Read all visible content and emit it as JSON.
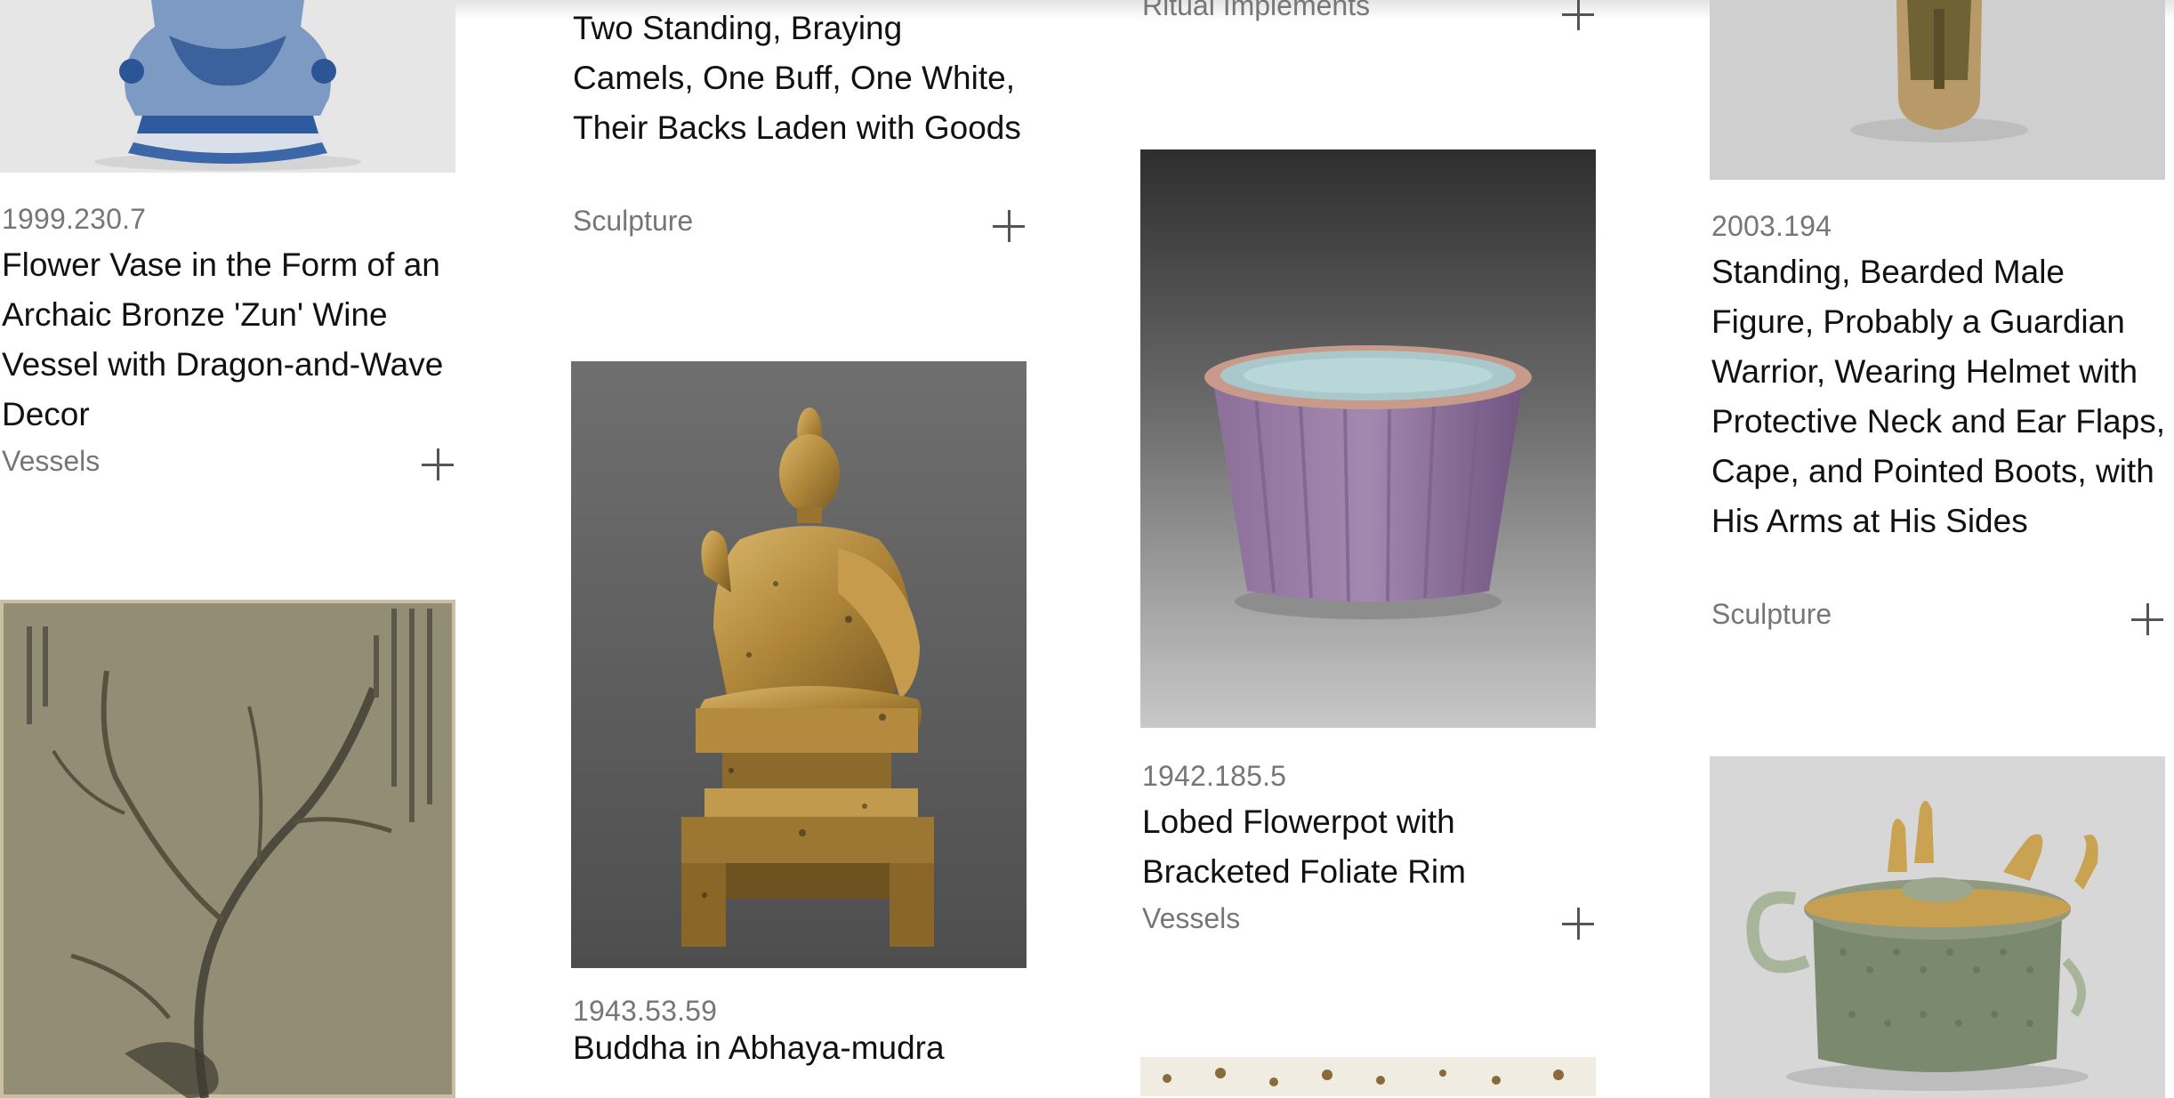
{
  "cards": {
    "vase_zun": {
      "accession": "1999.230.7",
      "title": "Flower Vase in the Form of an Archaic Bronze 'Zun' Wine Vessel with Dragon-and-Wave Decor",
      "department": "Vessels",
      "icon": "plus-icon"
    },
    "camels": {
      "title": "Two Standing, Braying Camels, One Buff, One White, Their Backs Laden with Goods",
      "department": "Sculpture",
      "icon": "plus-icon"
    },
    "buddha": {
      "accession": "1943.53.59",
      "title": "Buddha in Abhaya-mudra"
    },
    "ritual": {
      "department": "Ritual Implements",
      "icon": "plus-icon"
    },
    "flowerpot": {
      "accession": "1942.185.5",
      "title": "Lobed Flowerpot with Bracketed Foliate Rim",
      "department": "Vessels",
      "icon": "plus-icon"
    },
    "guardian": {
      "accession": "2003.194",
      "title": "Standing, Bearded Male Figure, Probably a Guardian Warrior, Wearing Helmet with Protective Neck and Ear Flaps, Cape, and Pointed Boots, with His Arms at His Sides",
      "department": "Sculpture",
      "icon": "plus-icon"
    }
  },
  "colors": {
    "secondary_text": "#767676",
    "primary_text": "#111111",
    "background": "#ffffff"
  }
}
